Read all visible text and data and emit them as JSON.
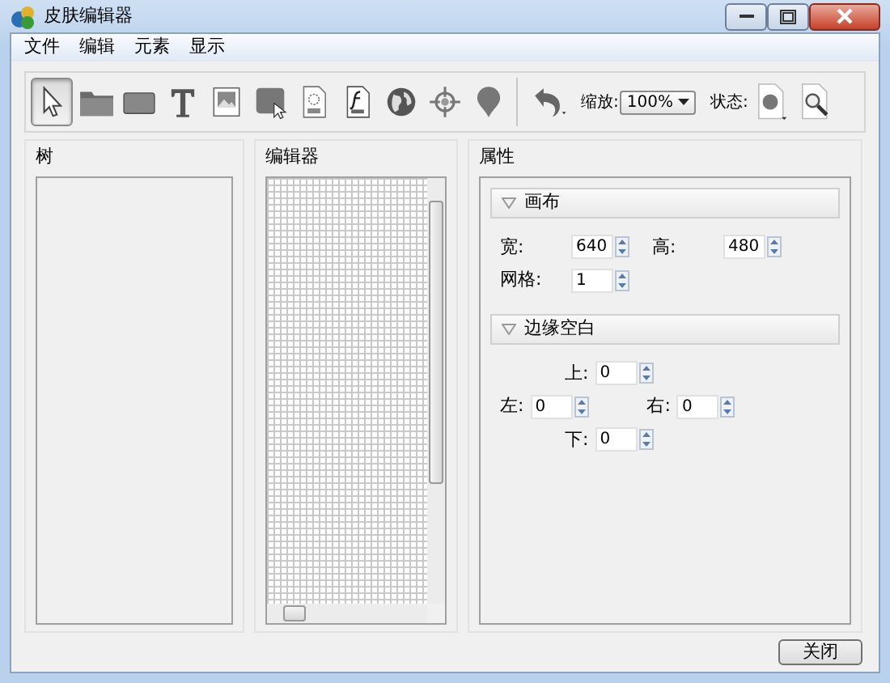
{
  "window": {
    "title": "皮肤编辑器"
  },
  "menu": [
    "文件",
    "编辑",
    "元素",
    "显示"
  ],
  "toolbar": {
    "tools": [
      {
        "kind": "pointer",
        "selected": true
      },
      {
        "kind": "folder",
        "selected": false
      },
      {
        "kind": "rectangle",
        "selected": false
      },
      {
        "kind": "text",
        "selected": false
      },
      {
        "kind": "image",
        "selected": false
      },
      {
        "kind": "button",
        "selected": false
      },
      {
        "kind": "svg",
        "selected": false
      },
      {
        "kind": "swf",
        "selected": false
      },
      {
        "kind": "globe",
        "selected": false
      },
      {
        "kind": "crosshair",
        "selected": false
      },
      {
        "kind": "pin",
        "selected": false
      }
    ],
    "zoom_label": "缩放:",
    "zoom_value": "100%",
    "state_label": "状态:"
  },
  "panels": {
    "tree": {
      "title": "树"
    },
    "editor": {
      "title": "编辑器"
    },
    "properties": {
      "title": "属性",
      "sections": [
        {
          "title": "画布",
          "expanded": true,
          "rows": [
            [
              {
                "label": "宽:",
                "value": "640"
              },
              {
                "label": "高:",
                "value": "480"
              }
            ],
            [
              {
                "label": "网格:",
                "value": "1"
              }
            ]
          ]
        },
        {
          "title": "边缘空白",
          "expanded": true,
          "rows": [
            [
              {
                "label": "上:",
                "value": "0"
              }
            ],
            [
              {
                "label": "左:",
                "value": "0"
              },
              {
                "label": "右:",
                "value": "0"
              }
            ],
            [
              {
                "label": "下:",
                "value": "0"
              }
            ]
          ]
        }
      ]
    }
  },
  "buttons": [
    "关闭"
  ]
}
